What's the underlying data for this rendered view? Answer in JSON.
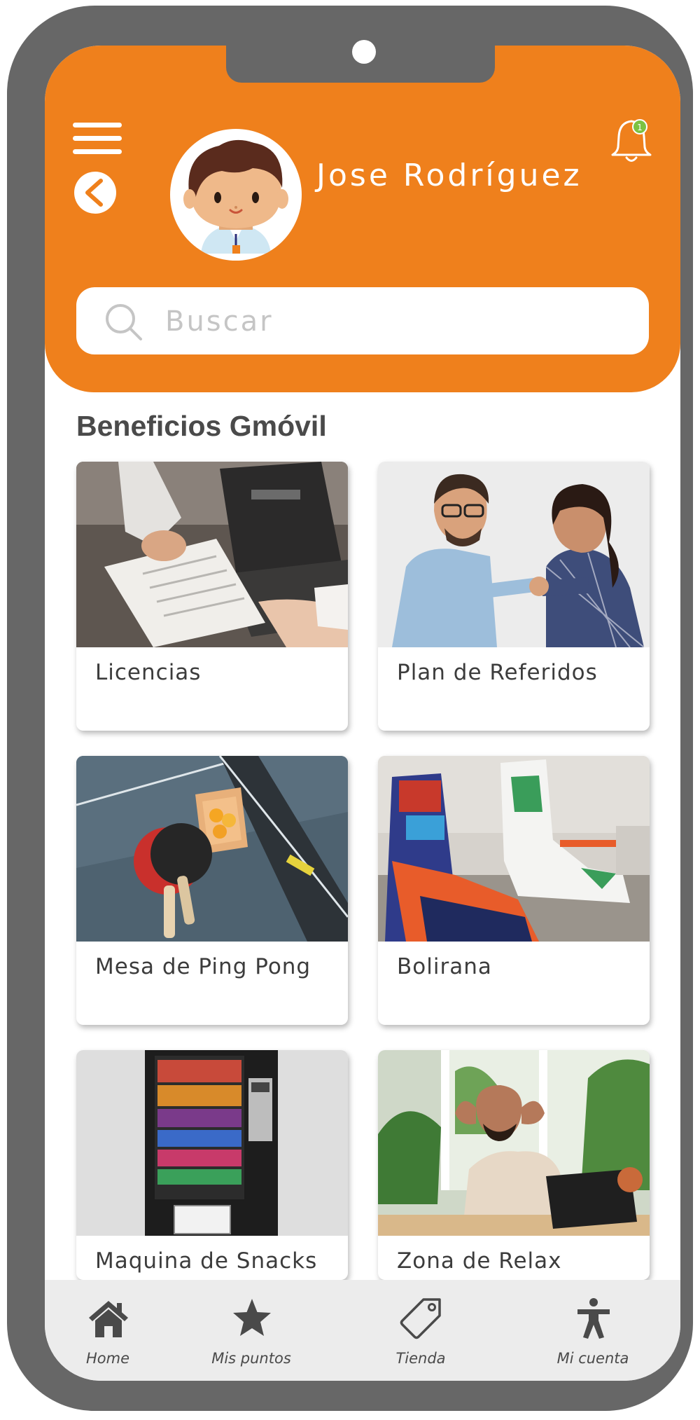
{
  "colors": {
    "accent": "#ef801c",
    "frame": "#676767",
    "nav_background": "#ececec",
    "notification_dot": "#7cc242"
  },
  "header": {
    "menu_icon": "hamburger-menu-icon",
    "back_icon": "back-arrow-icon",
    "bell_icon": "bell-icon",
    "notification_count": "1",
    "user_name": "Jose Rodríguez"
  },
  "search": {
    "placeholder": "Buscar",
    "value": "",
    "icon": "search-icon"
  },
  "section": {
    "title": "Beneficios Gmóvil"
  },
  "benefits": [
    {
      "label": "Licencias"
    },
    {
      "label": "Plan de Referidos"
    },
    {
      "label": "Mesa de Ping Pong"
    },
    {
      "label": "Bolirana"
    },
    {
      "label": "Maquina de Snacks"
    },
    {
      "label": "Zona de Relax"
    }
  ],
  "bottom_nav": [
    {
      "label": "Home",
      "icon": "home-icon"
    },
    {
      "label": "Mis puntos",
      "icon": "star-icon"
    },
    {
      "label": "Tienda",
      "icon": "tag-icon"
    },
    {
      "label": "Mi cuenta",
      "icon": "accessibility-person-icon"
    }
  ]
}
